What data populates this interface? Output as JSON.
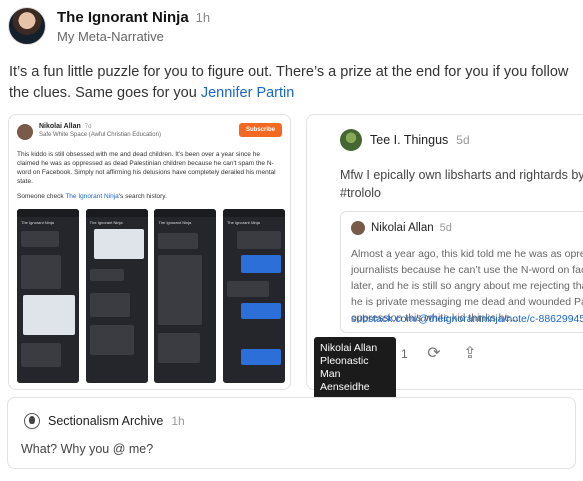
{
  "post": {
    "author": "The Ignorant Ninja",
    "time": "1h",
    "publication": "My Meta-Narrative",
    "body_text": "It’s a fun little puzzle for you to figure out. There’s a prize at the end for you if you follow the clues. Same goes for you ",
    "mention": "Jennifer Partin"
  },
  "left_card": {
    "author": "Nikolai Allan",
    "time": "7d",
    "publication": "Safe White Space (Awful Christian Education)",
    "subscribe_label": "Subscribe",
    "text": "This kiddo is still obsessed with me and dead children. It's been over a year since he claimed he was as oppressed as dead Palestinian children because he can't spam the N-word on Facebook. Simply not affirming his delusions have completely derailed his mental state.",
    "text2_prefix": "Someone check ",
    "text2_link": "The Ignorant Ninja",
    "text2_suffix": "'s search history.",
    "screenshot_title": "The Ignorant Ninja"
  },
  "right_card": {
    "author": "Tee I. Thingus",
    "time": "5d",
    "body_line1": "Mfw I epically own libsharts and rightards by sp",
    "body_line2": "#trololo",
    "quote": {
      "author": "Nikolai Allan",
      "time": "5d",
      "lines": [
        "Almost a year ago, this kid told me he was as opre",
        "journalists because he can’t use the N-word on face",
        "later, and he is still so angry about me rejecting that",
        "he is private messaging me dead and wounded Pale",
        "oppression this white kid thinks he..."
      ],
      "link": "substack.com/@theignorantninja/note/c-88629945"
    },
    "like_count": "1"
  },
  "tooltip": {
    "lines": [
      "Nikolai Allan",
      "Pleonastic Man",
      "Aenseidhe"
    ]
  },
  "comment": {
    "author": "Sectionalism Archive",
    "time": "1h",
    "body": "What? Why you @ me?"
  }
}
